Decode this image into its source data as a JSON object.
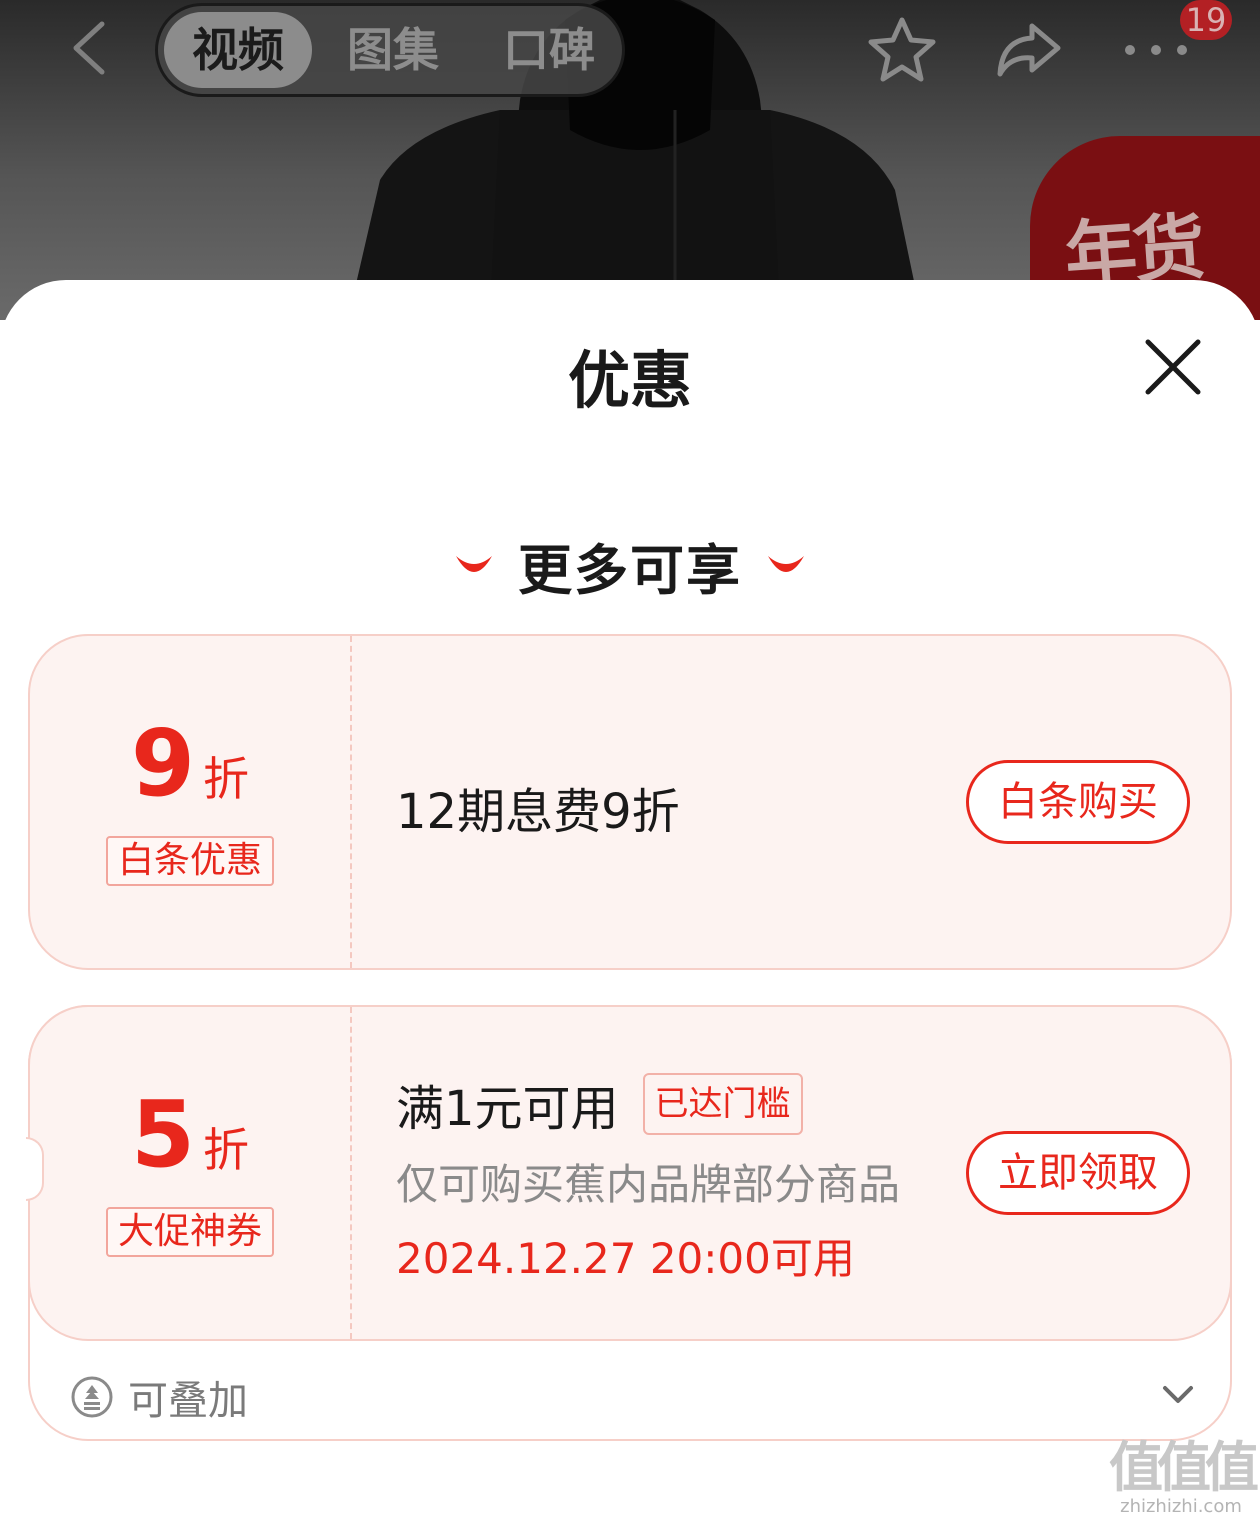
{
  "header": {
    "tabs": [
      {
        "label": "视频",
        "active": true
      },
      {
        "label": "图集",
        "active": false
      },
      {
        "label": "口碑",
        "active": false
      }
    ],
    "icons": [
      "back-icon",
      "star-icon",
      "share-icon",
      "more-icon"
    ],
    "message_badge": "19",
    "festival_label": "年货节"
  },
  "sheet": {
    "title": "优惠",
    "section_title": "更多可享",
    "coupons": [
      {
        "discount_value": "9",
        "discount_unit": "折",
        "tag": "白条优惠",
        "description": "12期息费9折",
        "action": "白条购买"
      },
      {
        "discount_value": "5",
        "discount_unit": "折",
        "tag": "大促神券",
        "condition": "满1元可用",
        "status_tag": "已达门槛",
        "scope": "仅可购买蕉内品牌部分商品",
        "available_time": "2024.12.27 20:00可用",
        "action": "立即领取",
        "stackable_label": "可叠加"
      }
    ]
  },
  "watermark": {
    "main": "值值值",
    "sub": "zhizhizhi.com"
  },
  "colors": {
    "accent": "#e8271c",
    "card_bg": "#fdf3f1",
    "card_border": "#f6cfc8"
  }
}
